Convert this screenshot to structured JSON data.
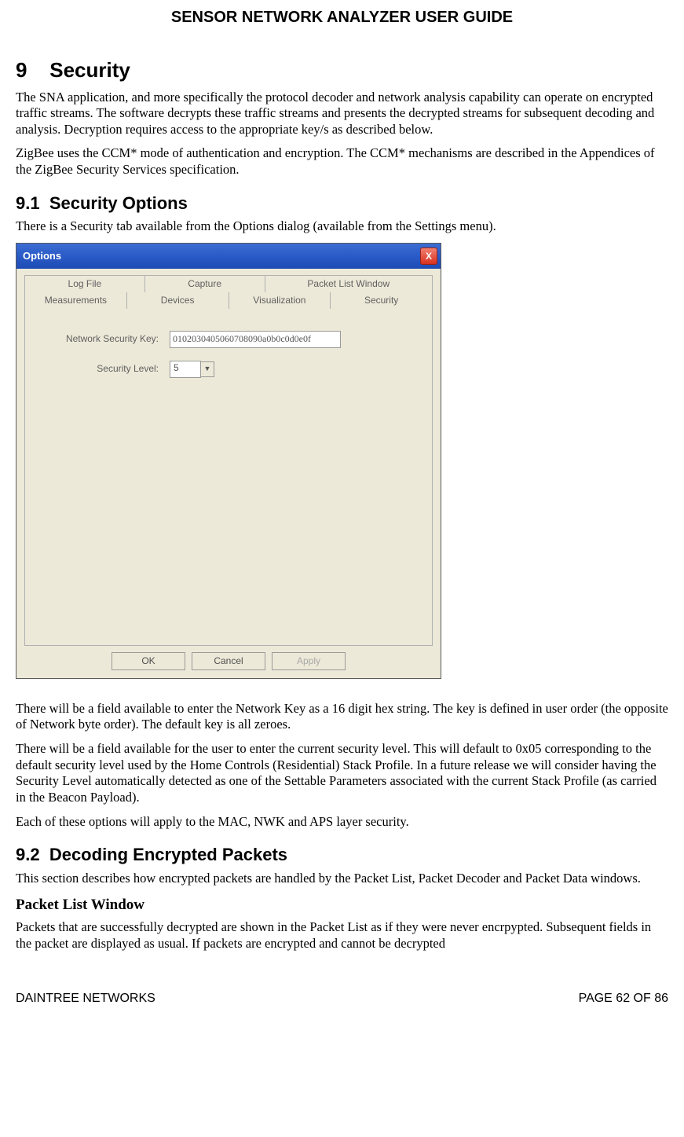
{
  "doc_title": "SENSOR NETWORK ANALYZER USER GUIDE",
  "section": {
    "num": "9",
    "title": "Security"
  },
  "p1": "The SNA application, and more specifically the protocol decoder and network analysis capability can operate on encrypted traffic streams. The software decrypts these traffic streams and presents the decrypted streams for subsequent decoding and analysis. Decryption requires access to the appropriate key/s as described below.",
  "p2": "ZigBee uses the CCM* mode of authentication and encryption. The CCM* mechanisms are described in the Appendices of the ZigBee Security Services specification.",
  "sub1": {
    "num": "9.1",
    "title": "Security Options"
  },
  "p3": "There is a Security tab available from the Options dialog (available from the Settings menu).",
  "dialog": {
    "title": "Options",
    "close": "X",
    "tabs_row1": [
      "Log File",
      "Capture",
      "Packet List Window"
    ],
    "tabs_row2": [
      "Measurements",
      "Devices",
      "Visualization",
      "Security"
    ],
    "key_label": "Network Security Key:",
    "key_value": "0102030405060708090a0b0c0d0e0f",
    "level_label": "Security Level:",
    "level_value": "5",
    "ok": "OK",
    "cancel": "Cancel",
    "apply": "Apply"
  },
  "p4": "There will be a field available to enter the Network Key as a 16 digit hex string. The key is defined in user order (the opposite of Network byte order). The default key is all zeroes.",
  "p5": "There will be a field available for the user to enter the current security level. This will default to 0x05 corresponding to the default security level used by the Home Controls (Residential) Stack Profile. In a future release we will consider having the Security Level automatically detected as one of the Settable Parameters associated with the current Stack Profile (as carried in the Beacon Payload).",
  "p6": "Each of these options will apply to the MAC, NWK and APS layer security.",
  "sub2": {
    "num": "9.2",
    "title": "Decoding Encrypted Packets"
  },
  "p7": "This section describes how encrypted packets are handled by the Packet List, Packet Decoder and Packet Data windows.",
  "subsub": "Packet List Window",
  "p8": "Packets that are successfully decrypted are shown in the Packet List as if they were never encrpypted. Subsequent fields in the packet are displayed as usual. If packets are encrypted and cannot be decrypted",
  "footer_left": "DAINTREE NETWORKS",
  "footer_right": "PAGE 62 OF 86"
}
